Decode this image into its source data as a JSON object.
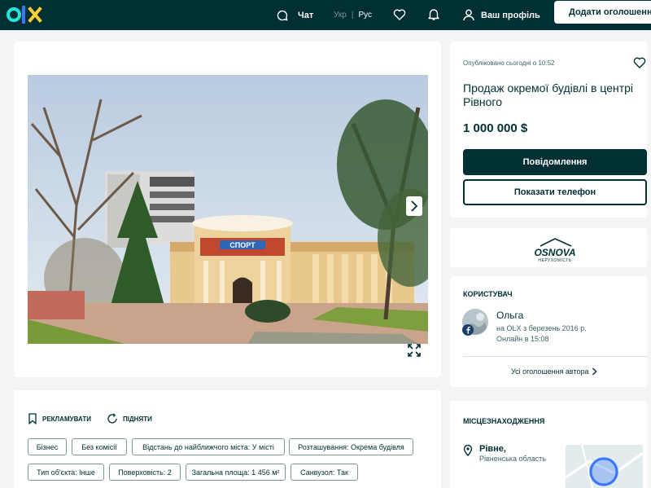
{
  "header": {
    "chat_label": "Чат",
    "lang_ukr": "Укр",
    "lang_separator": "|",
    "lang_rus": "Рус",
    "profile_label": "Ваш профіль",
    "add_button_label": "Додати оголошення"
  },
  "ad": {
    "published": "Опубліковано сьогодні о 10:52",
    "title": "Продаж окремої будівлі в центрі Рівного",
    "price": "1 000 000 $",
    "message_button": "Повідомлення",
    "phone_button": "Показати телефон"
  },
  "photo": {
    "sign_text": "СПОРТ"
  },
  "agency": {
    "logo_name": "OSNOVA",
    "logo_sub": "НЕРУХОМІСТЬ"
  },
  "user": {
    "section_title": "КОРИСТУВАЧ",
    "name": "Ольга",
    "since": "на OLX з березень 2016 р.",
    "online": "Онлайн в 15:08",
    "all_ads": "Усі оголошення автора"
  },
  "location": {
    "section_title": "МІСЦЕЗНАХОДЖЕННЯ",
    "city": "Рівне,",
    "region": "Рівненська область"
  },
  "actions": {
    "promote": "РЕКЛАМУВАТИ",
    "raise": "ПІДНЯТИ"
  },
  "tags": [
    "Бізнес",
    "Без комісії",
    "Відстань до найближчого міста: У місті",
    "Розташування: Окрема будівля",
    "Тип об'єкта: Інше",
    "Поверховість: 2",
    "Загальна площа: 1 456 м²",
    "Санвузол: Так"
  ],
  "colors": {
    "brand": "#002f34",
    "background": "#f2f4f5",
    "logo_accent": "#23e5db"
  }
}
